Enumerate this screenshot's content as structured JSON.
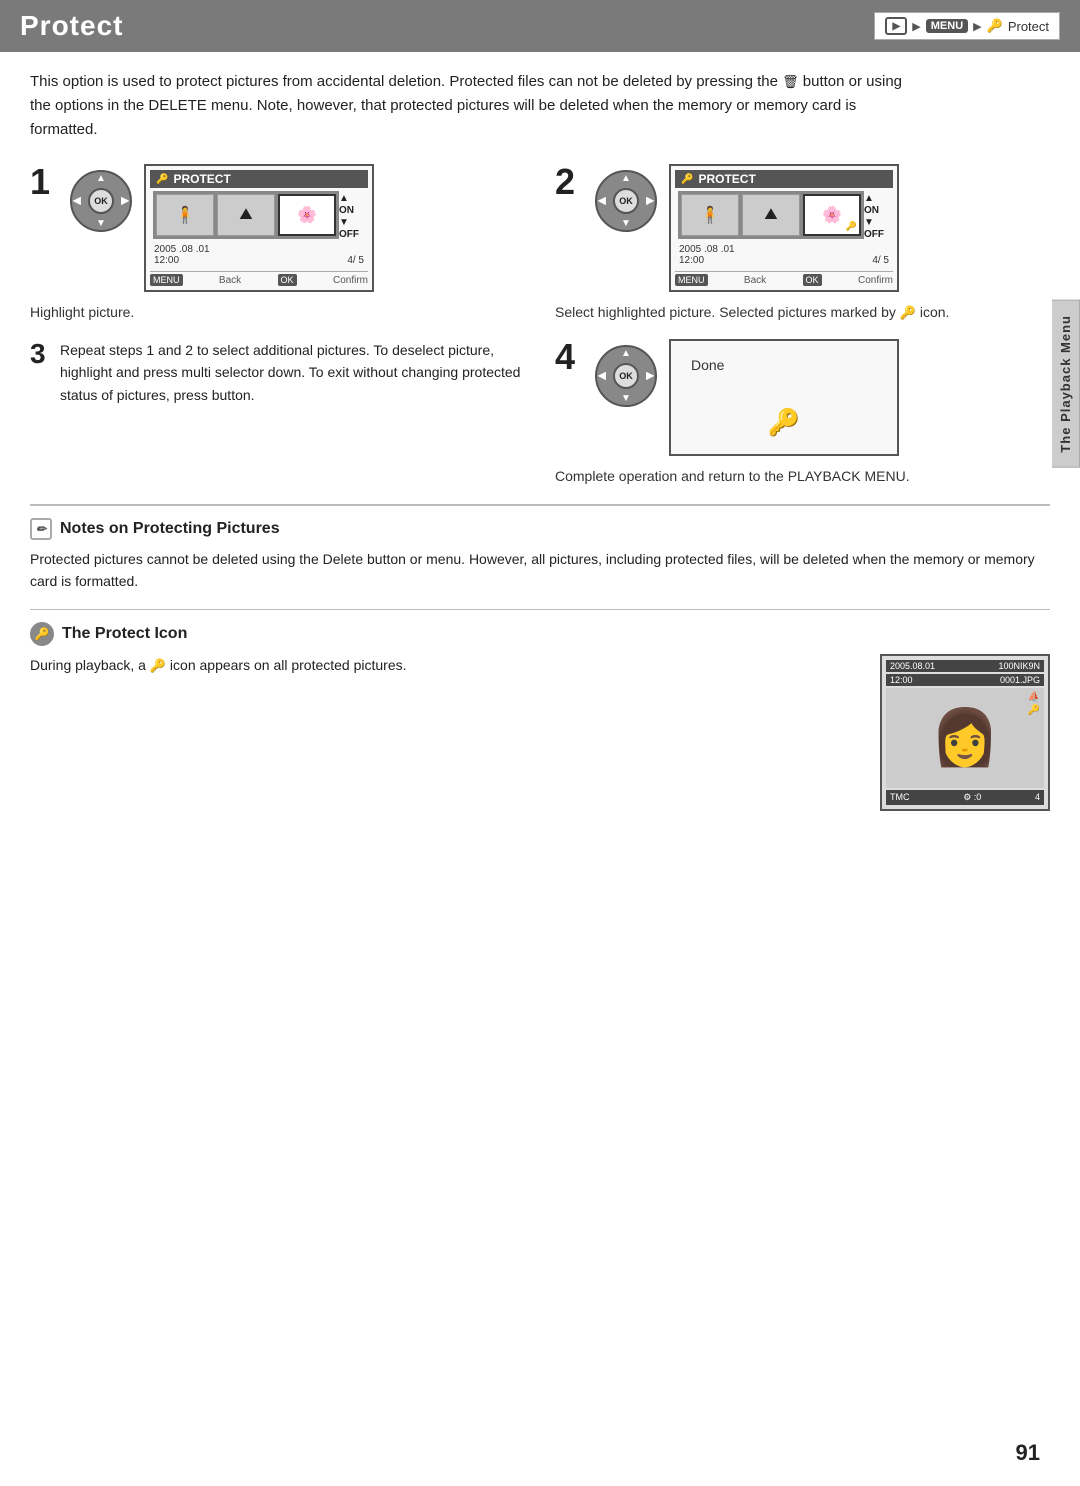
{
  "header": {
    "title": "Protect",
    "breadcrumb": {
      "playback_icon": "▶",
      "menu_label": "MENU",
      "protect_icon": "🔑",
      "protect_text": "Protect"
    }
  },
  "intro": {
    "text": "This option is used to protect pictures from accidental deletion. Protected files can not be deleted by pressing the  button or using the options in the DELETE menu. Note, however, that protected pictures will be deleted when the memory or memory card is formatted."
  },
  "steps": {
    "step1": {
      "number": "1",
      "screen_title": "PROTECT",
      "date": "2005 .08 .01",
      "time": "12:00",
      "counter": "4/  5",
      "on_label": "▲ ON",
      "off_label": "▼ OFF",
      "back_label": "Back",
      "confirm_label": "Confirm",
      "description": "Highlight picture."
    },
    "step2": {
      "number": "2",
      "screen_title": "PROTECT",
      "date": "2005 .08 .01",
      "time": "12:00",
      "counter": "4/  5",
      "on_label": "▲ ON",
      "off_label": "▼ OFF",
      "back_label": "Back",
      "confirm_label": "Confirm",
      "description": "Select highlighted picture. Selected pictures marked by",
      "description2": "icon."
    },
    "step3": {
      "number": "3",
      "text": "Repeat steps 1 and 2 to select additional pictures. To deselect picture, highlight and press multi selector down. To exit without changing protected status of pictures, press  button."
    },
    "step4": {
      "number": "4",
      "done_label": "Done",
      "lock_symbol": "🔑",
      "description": "Complete operation and return to the PLAYBACK MENU."
    }
  },
  "notes": {
    "title": "Notes on Protecting Pictures",
    "text": "Protected pictures cannot be deleted using the Delete button or menu. However, all pictures, including protected files, will be deleted when the memory or memory card is formatted.",
    "protect_icon_title": "The Protect Icon",
    "protect_icon_text": "During playback, a",
    "protect_icon_text2": "icon appears on all protected pictures."
  },
  "sidebar": {
    "label": "The Playback Menu"
  },
  "page": {
    "number": "91"
  }
}
